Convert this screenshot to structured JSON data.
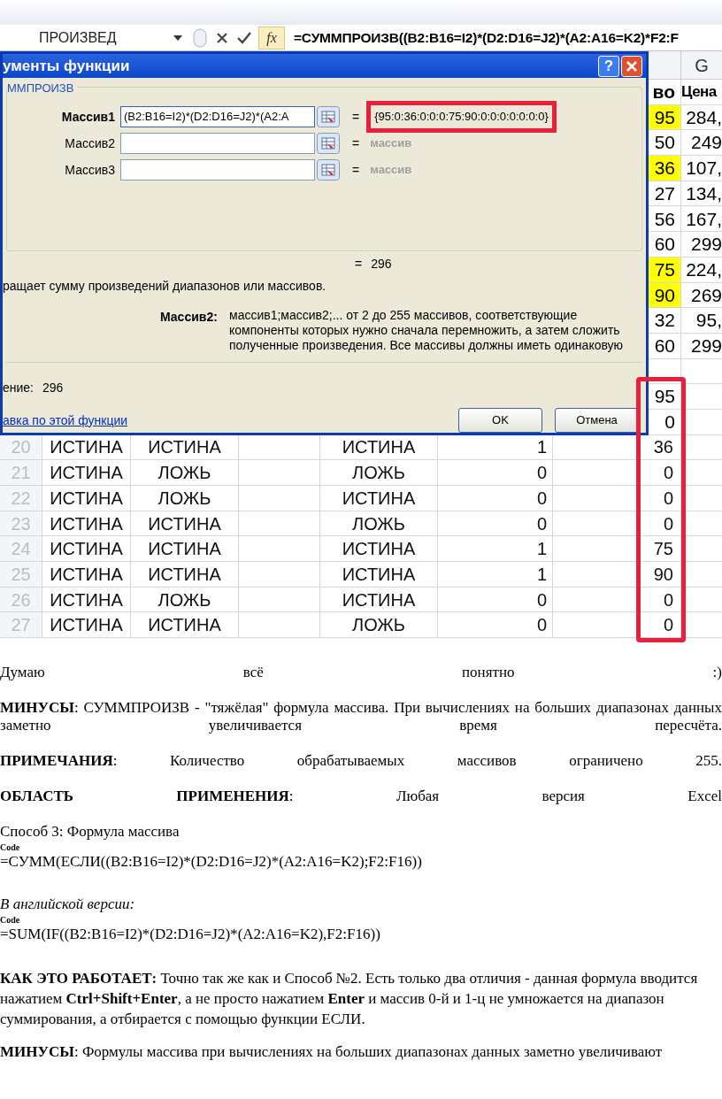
{
  "formula_bar": {
    "name_box": "ПРОИЗВЕД",
    "fx_label": "fx",
    "formula": "=СУММПРОИЗВ((B2:B16=I2)*(D2:D16=J2)*(A2:A16=K2)*F2:F"
  },
  "sheet": {
    "column_header": "G",
    "top_rows": [
      {
        "value": "во",
        "price": "Цена",
        "kind": "header",
        "highlighted": false
      },
      {
        "value": "95",
        "price": "284,",
        "kind": "data",
        "highlighted": true
      },
      {
        "value": "50",
        "price": "249",
        "kind": "data",
        "highlighted": false
      },
      {
        "value": "36",
        "price": "107,",
        "kind": "data",
        "highlighted": true
      },
      {
        "value": "27",
        "price": "134,",
        "kind": "data",
        "highlighted": false
      },
      {
        "value": "56",
        "price": "167,",
        "kind": "data",
        "highlighted": false
      },
      {
        "value": "60",
        "price": "299",
        "kind": "data",
        "highlighted": false
      },
      {
        "value": "75",
        "price": "224,",
        "kind": "data",
        "highlighted": true
      },
      {
        "value": "90",
        "price": "269",
        "kind": "data",
        "highlighted": true
      },
      {
        "value": "32",
        "price": "95,",
        "kind": "data",
        "highlighted": false
      },
      {
        "value": "60",
        "price": "299",
        "kind": "data",
        "highlighted": false
      },
      {
        "kind": "blank",
        "highlighted": false
      },
      {
        "value": "95",
        "kind": "data",
        "highlighted": false
      },
      {
        "value": "0",
        "kind": "data",
        "highlighted": false
      }
    ],
    "rows": [
      {
        "row": "20",
        "a": "ИСТИНА",
        "b": "ИСТИНА",
        "d": "ИСТИНА",
        "e": "1",
        "value": "36"
      },
      {
        "row": "21",
        "a": "ИСТИНА",
        "b": "ЛОЖЬ",
        "d": "ЛОЖЬ",
        "e": "0",
        "value": "0"
      },
      {
        "row": "22",
        "a": "ИСТИНА",
        "b": "ЛОЖЬ",
        "d": "ИСТИНА",
        "e": "0",
        "value": "0"
      },
      {
        "row": "23",
        "a": "ИСТИНА",
        "b": "ИСТИНА",
        "d": "ЛОЖЬ",
        "e": "0",
        "value": "0"
      },
      {
        "row": "24",
        "a": "ИСТИНА",
        "b": "ИСТИНА",
        "d": "ИСТИНА",
        "e": "1",
        "value": "75"
      },
      {
        "row": "25",
        "a": "ИСТИНА",
        "b": "ИСТИНА",
        "d": "ИСТИНА",
        "e": "1",
        "value": "90"
      },
      {
        "row": "26",
        "a": "ИСТИНА",
        "b": "ЛОЖЬ",
        "d": "ИСТИНА",
        "e": "0",
        "value": "0"
      },
      {
        "row": "27",
        "a": "ИСТИНА",
        "b": "ИСТИНА",
        "d": "ЛОЖЬ",
        "e": "0",
        "value": "0"
      }
    ]
  },
  "dialog": {
    "title": "ументы функции",
    "help_button": "?",
    "group": "ММПРОИЗВ",
    "arguments": [
      {
        "label": "Массив1",
        "value": "(B2:B16=I2)*(D2:D16=J2)*(A2:A",
        "sign": "=",
        "result": "{95:0:36:0:0:0:75:90:0:0:0:0:0:0:0}",
        "active": true,
        "highlighted": true
      },
      {
        "label": "Массив2",
        "sign": "=",
        "result": "массив",
        "active": false,
        "highlighted": false
      },
      {
        "label": "Массив3",
        "sign": "=",
        "result": "массив",
        "active": false,
        "highlighted": false
      }
    ],
    "formula_result": {
      "sign": "=",
      "value": "296"
    },
    "description": "ращает сумму произведений диапазонов или массивов.",
    "argument_help": {
      "label": "Массив2:",
      "text": "массив1;массив2;... от 2 до 255 массивов, соответствующие компоненты которых нужно сначала перемножить, а затем сложить полученные произведения. Все массивы должны иметь одинаковую"
    },
    "value": {
      "label": "ение:",
      "value": "296"
    },
    "help_link": "авка по этой функции",
    "buttons": [
      "OK",
      "Отмена"
    ]
  },
  "article": [
    {
      "kind": "justified",
      "text": "Думаю всё понятно :)"
    },
    {
      "kind": "justified",
      "text": "**МИНУСЫ**: СУММПРОИЗВ - \"тяжёлая\" формула массива. При вычислениях на больших диапазонах данных заметно увеличивается время пересчёта."
    },
    {
      "kind": "justified",
      "text": "**ПРИМЕЧАНИЯ**: Количество обрабатываемых массивов ограничено 255."
    },
    {
      "kind": "justified",
      "text": "**ОБЛАСТЬ ПРИМЕНЕНИЯ**: Любая версия Excel"
    },
    {
      "kind": "heading",
      "text": "Способ 3: Формула массива"
    },
    {
      "kind": "code_label",
      "text": "Code"
    },
    {
      "kind": "code",
      "text": "=СУММ(ЕСЛИ((B2:B16=I2)*(D2:D16=J2)*(A2:A16=K2);F2:F16))"
    },
    {
      "kind": "italic",
      "text": "В английской версии:"
    },
    {
      "kind": "code_label",
      "text": "Code"
    },
    {
      "kind": "code",
      "text": "=SUM(IF((B2:B16=I2)*(D2:D16=J2)*(A2:A16=K2),F2:F16))"
    },
    {
      "kind": "text",
      "text": "**КАК ЭТО РАБОТАЕТ:**  Точно так же как и Способ №2. Есть только два отличия - данная формула вводится нажатием **Ctrl+Shift+Enter**, а не просто нажатием **Enter** и массив 0-й и 1-ц не умножается на диапазон суммирования, а отбирается с помощью функции ЕСЛИ."
    },
    {
      "kind": "text",
      "text": "**МИНУСЫ**: Формулы массива при вычислениях на больших диапазонах данных заметно увеличивают"
    }
  ]
}
